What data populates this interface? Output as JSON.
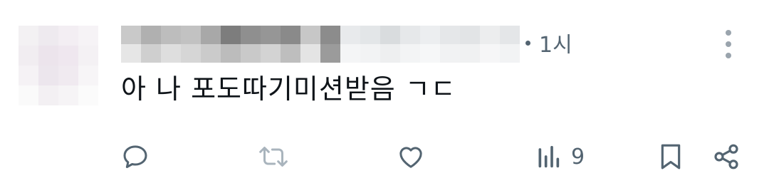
{
  "tweet": {
    "time": "1시",
    "text": "아 나 포도따기미션받음 ㄱㄷ"
  },
  "actions": {
    "views_count": "9"
  },
  "colors": {
    "icon": "#536471",
    "icon_faded": "#a9b4bd",
    "text": "#0f1419"
  },
  "icons": [
    "reply-icon",
    "retweet-icon",
    "like-icon",
    "views-icon",
    "bookmark-icon",
    "share-icon",
    "more-icon"
  ]
}
